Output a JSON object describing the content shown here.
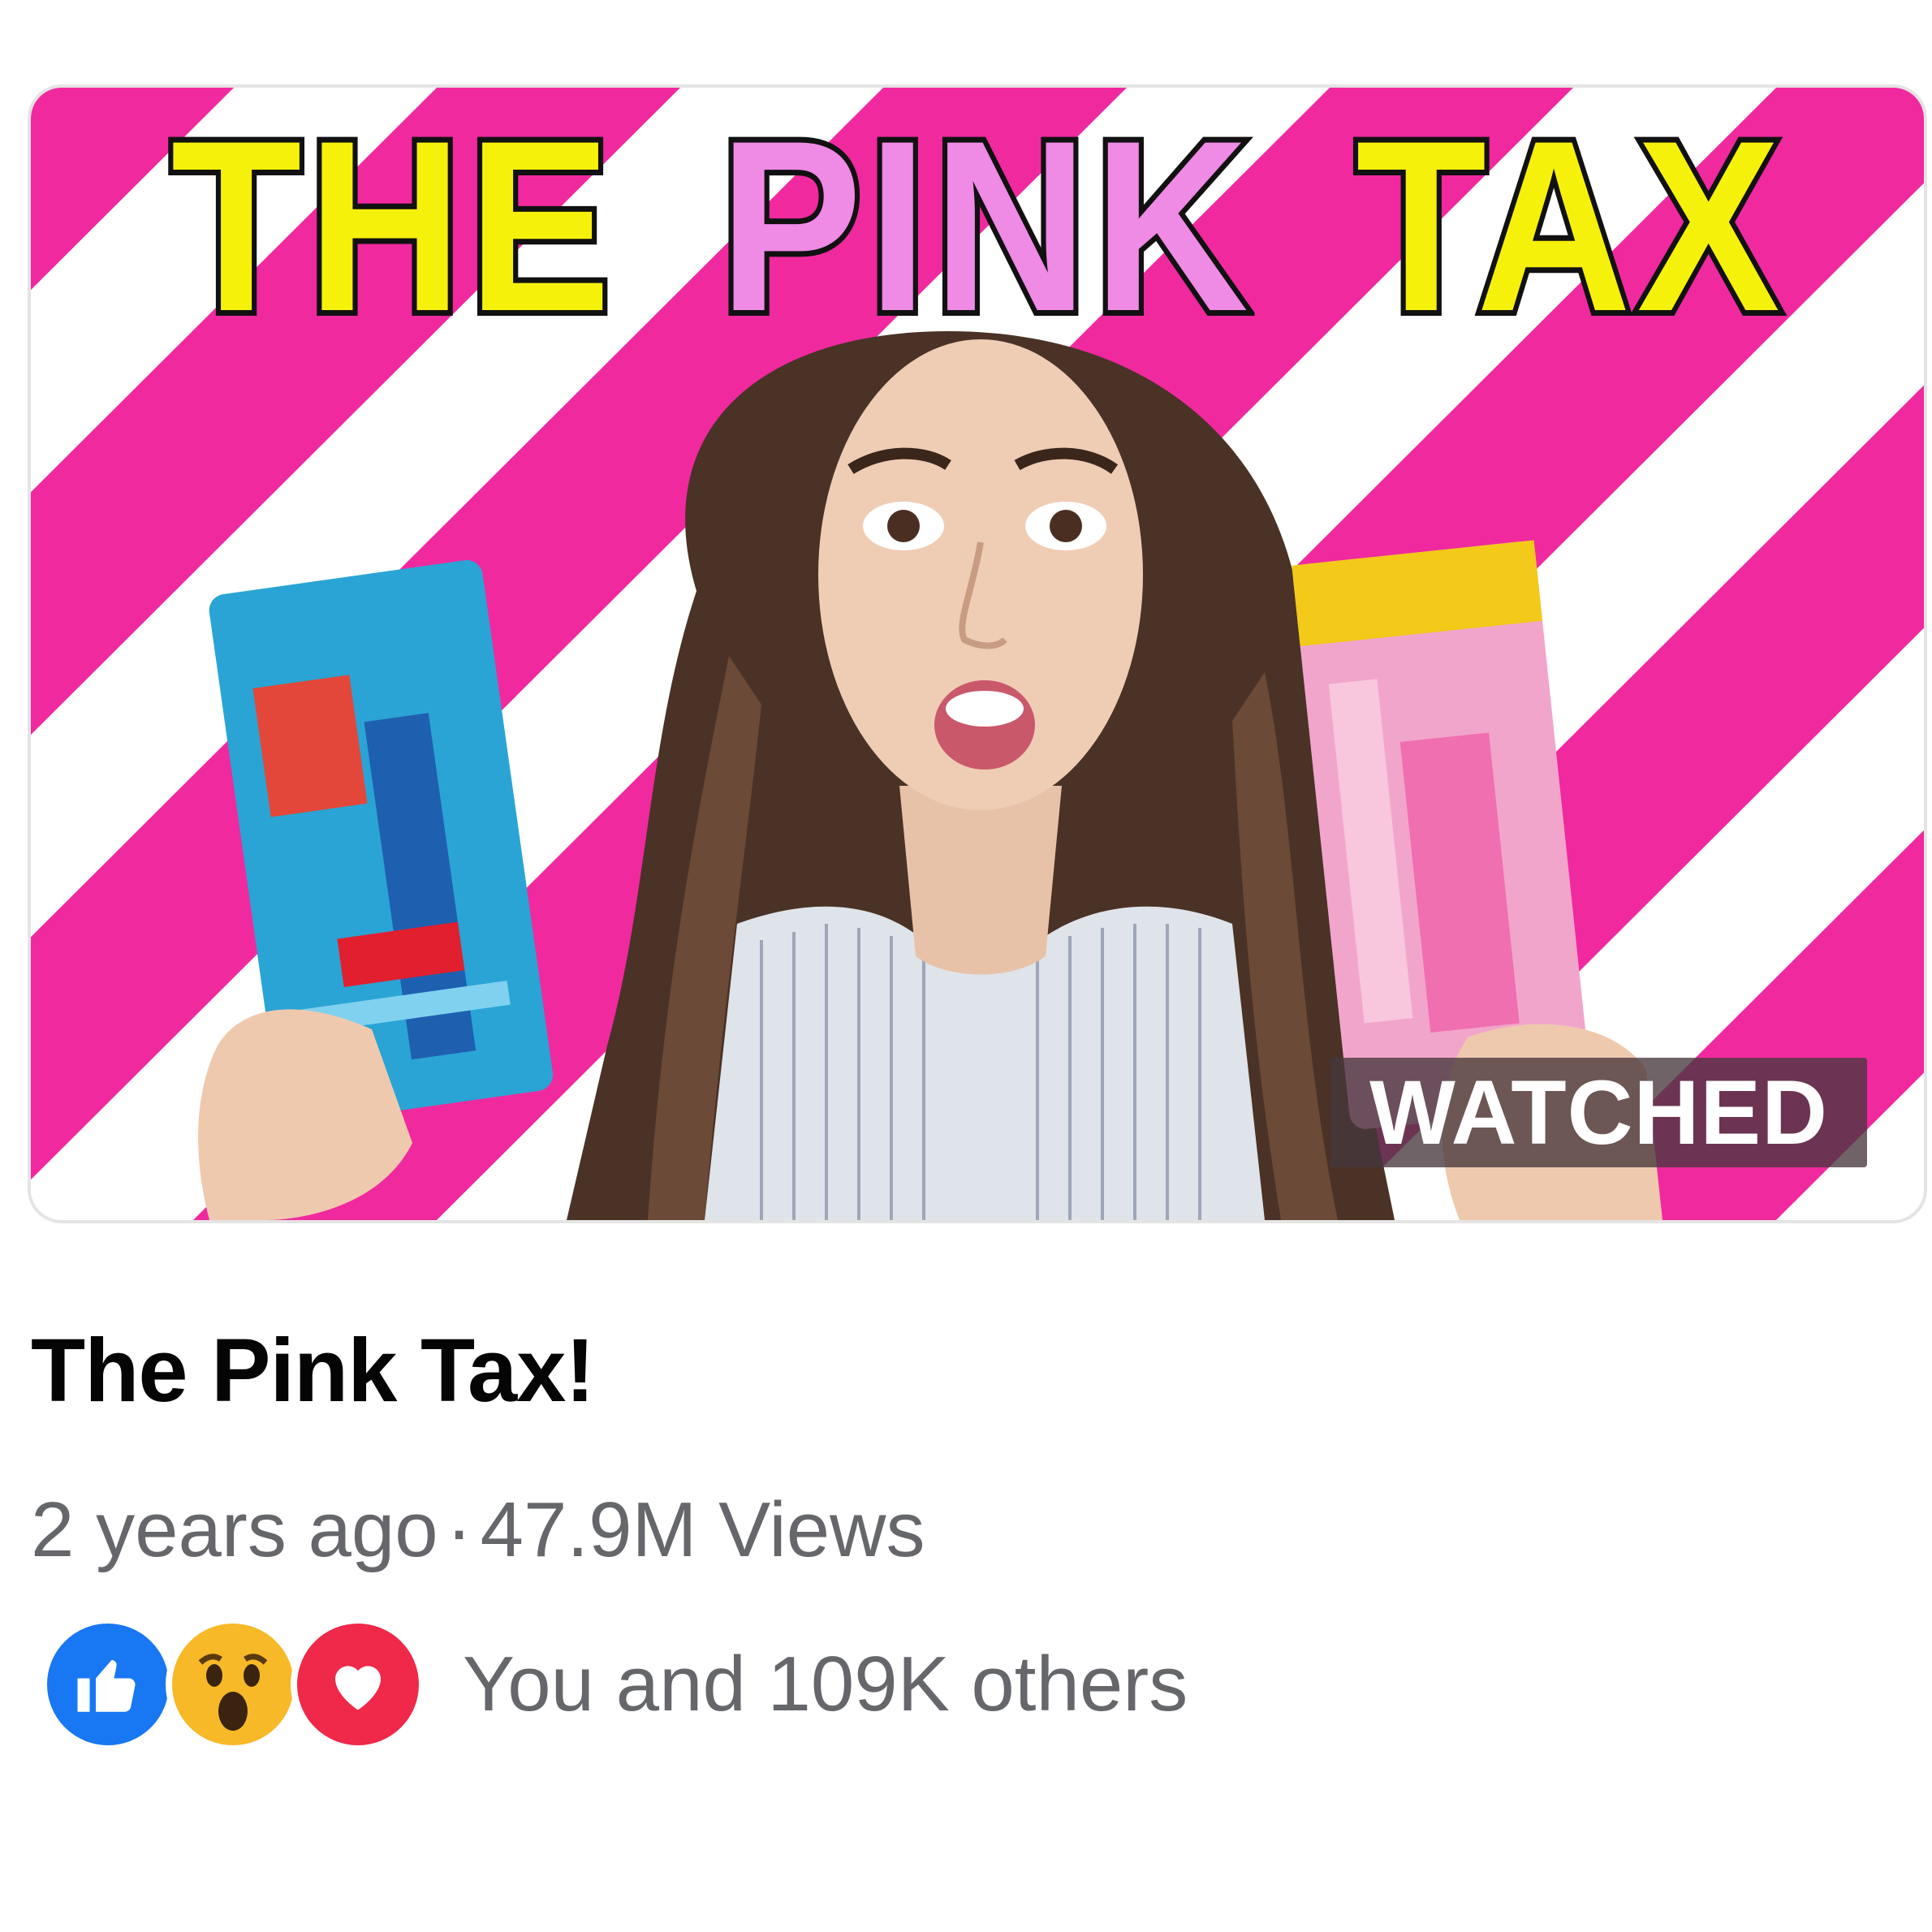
{
  "video": {
    "thumbnail_headline": [
      "THE",
      "PINK",
      "TAX"
    ],
    "watched_badge": "WATCHED",
    "title": "The Pink Tax!",
    "age": "2 years ago",
    "separator": "·",
    "views": "47.9M Views",
    "reactions": {
      "icons": [
        "like-icon",
        "wow-icon",
        "love-icon"
      ],
      "summary": "You and 109K others"
    }
  },
  "colors": {
    "stripe_pink": "#f0299f",
    "headline_yellow": "#f6f10a",
    "headline_pink": "#ef8ae5",
    "like_blue": "#1877f2",
    "love_red": "#f02849",
    "wow_yellow": "#f7b928",
    "meta_gray": "#65676b"
  }
}
